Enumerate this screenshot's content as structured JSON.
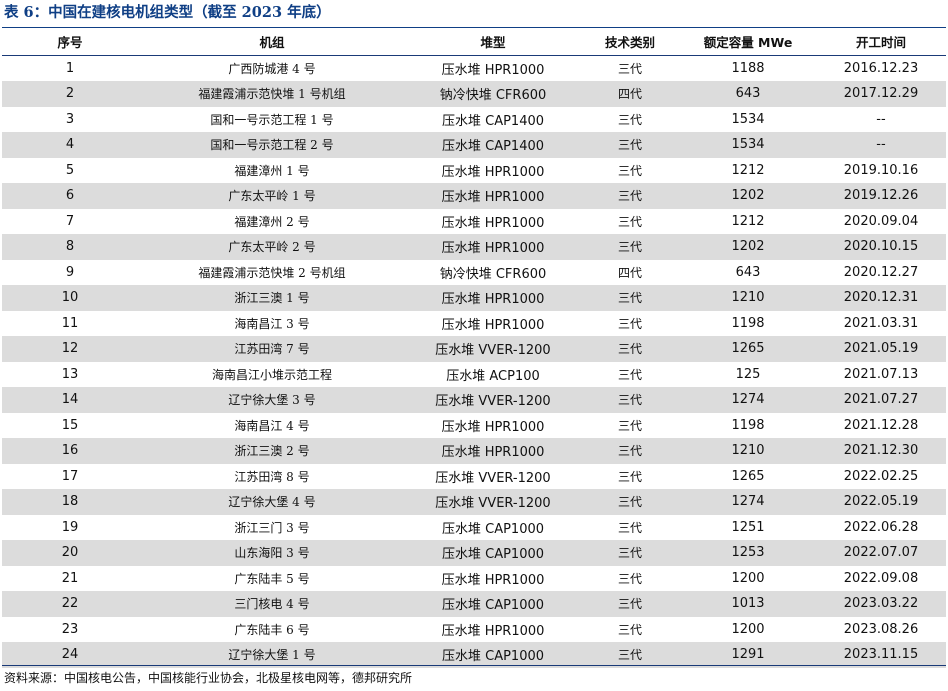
{
  "title": "表 6：中国在建核电机组类型（截至 2023 年底）",
  "table": {
    "headers": {
      "no": "序号",
      "unit": "机组",
      "reactor": "堆型",
      "generation": "技术类别",
      "capacity": "额定容量 MWe",
      "start": "开工时间"
    },
    "rows": [
      {
        "no": "1",
        "unit": "广西防城港 4 号",
        "reactor": "压水堆 HPR1000",
        "generation": "三代",
        "capacity": "1188",
        "start": "2016.12.23"
      },
      {
        "no": "2",
        "unit": "福建霞浦示范快堆 1 号机组",
        "reactor": "钠冷快堆 CFR600",
        "generation": "四代",
        "capacity": "643",
        "start": "2017.12.29"
      },
      {
        "no": "3",
        "unit": "国和一号示范工程 1 号",
        "reactor": "压水堆 CAP1400",
        "generation": "三代",
        "capacity": "1534",
        "start": "--"
      },
      {
        "no": "4",
        "unit": "国和一号示范工程 2 号",
        "reactor": "压水堆 CAP1400",
        "generation": "三代",
        "capacity": "1534",
        "start": "--"
      },
      {
        "no": "5",
        "unit": "福建漳州 1 号",
        "reactor": "压水堆 HPR1000",
        "generation": "三代",
        "capacity": "1212",
        "start": "2019.10.16"
      },
      {
        "no": "6",
        "unit": "广东太平岭 1 号",
        "reactor": "压水堆 HPR1000",
        "generation": "三代",
        "capacity": "1202",
        "start": "2019.12.26"
      },
      {
        "no": "7",
        "unit": "福建漳州 2 号",
        "reactor": "压水堆 HPR1000",
        "generation": "三代",
        "capacity": "1212",
        "start": "2020.09.04"
      },
      {
        "no": "8",
        "unit": "广东太平岭 2 号",
        "reactor": "压水堆 HPR1000",
        "generation": "三代",
        "capacity": "1202",
        "start": "2020.10.15"
      },
      {
        "no": "9",
        "unit": "福建霞浦示范快堆 2 号机组",
        "reactor": "钠冷快堆 CFR600",
        "generation": "四代",
        "capacity": "643",
        "start": "2020.12.27"
      },
      {
        "no": "10",
        "unit": "浙江三澳 1 号",
        "reactor": "压水堆 HPR1000",
        "generation": "三代",
        "capacity": "1210",
        "start": "2020.12.31"
      },
      {
        "no": "11",
        "unit": "海南昌江 3 号",
        "reactor": "压水堆 HPR1000",
        "generation": "三代",
        "capacity": "1198",
        "start": "2021.03.31"
      },
      {
        "no": "12",
        "unit": "江苏田湾 7 号",
        "reactor": "压水堆 VVER-1200",
        "generation": "三代",
        "capacity": "1265",
        "start": "2021.05.19"
      },
      {
        "no": "13",
        "unit": "海南昌江小堆示范工程",
        "reactor": "压水堆 ACP100",
        "generation": "三代",
        "capacity": "125",
        "start": "2021.07.13"
      },
      {
        "no": "14",
        "unit": "辽宁徐大堡 3 号",
        "reactor": "压水堆 VVER-1200",
        "generation": "三代",
        "capacity": "1274",
        "start": "2021.07.27"
      },
      {
        "no": "15",
        "unit": "海南昌江 4 号",
        "reactor": "压水堆 HPR1000",
        "generation": "三代",
        "capacity": "1198",
        "start": "2021.12.28"
      },
      {
        "no": "16",
        "unit": "浙江三澳 2 号",
        "reactor": "压水堆 HPR1000",
        "generation": "三代",
        "capacity": "1210",
        "start": "2021.12.30"
      },
      {
        "no": "17",
        "unit": "江苏田湾 8 号",
        "reactor": "压水堆 VVER-1200",
        "generation": "三代",
        "capacity": "1265",
        "start": "2022.02.25"
      },
      {
        "no": "18",
        "unit": "辽宁徐大堡 4 号",
        "reactor": "压水堆 VVER-1200",
        "generation": "三代",
        "capacity": "1274",
        "start": "2022.05.19"
      },
      {
        "no": "19",
        "unit": "浙江三门 3 号",
        "reactor": "压水堆 CAP1000",
        "generation": "三代",
        "capacity": "1251",
        "start": "2022.06.28"
      },
      {
        "no": "20",
        "unit": "山东海阳 3 号",
        "reactor": "压水堆 CAP1000",
        "generation": "三代",
        "capacity": "1253",
        "start": "2022.07.07"
      },
      {
        "no": "21",
        "unit": "广东陆丰 5 号",
        "reactor": "压水堆 HPR1000",
        "generation": "三代",
        "capacity": "1200",
        "start": "2022.09.08"
      },
      {
        "no": "22",
        "unit": "三门核电 4 号",
        "reactor": "压水堆 CAP1000",
        "generation": "三代",
        "capacity": "1013",
        "start": "2023.03.22"
      },
      {
        "no": "23",
        "unit": "广东陆丰 6 号",
        "reactor": "压水堆 HPR1000",
        "generation": "三代",
        "capacity": "1200",
        "start": "2023.08.26"
      },
      {
        "no": "24",
        "unit": "辽宁徐大堡 1 号",
        "reactor": "压水堆 CAP1000",
        "generation": "三代",
        "capacity": "1291",
        "start": "2023.11.15"
      }
    ]
  },
  "source": "资料来源：中国核电公告，中国核能行业协会，北极星核电网等，德邦研究所",
  "colors": {
    "title": "#0f3f85",
    "rule": "#1a3a78",
    "stripe": "#dcdcdc"
  }
}
